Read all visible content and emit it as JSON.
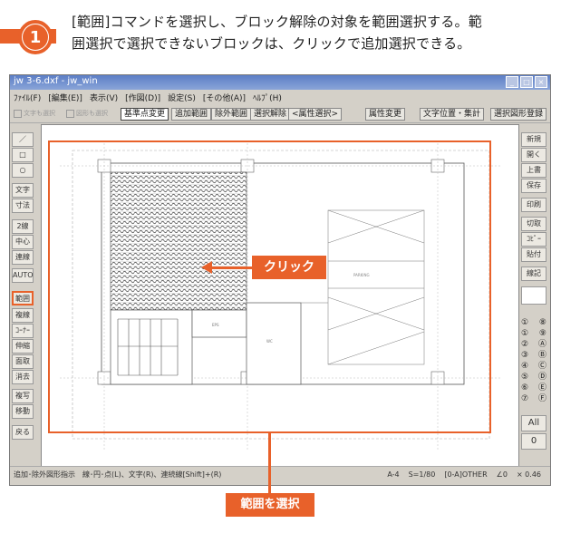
{
  "step": {
    "number": "1"
  },
  "instruction": {
    "line1": "[範囲]コマンドを選択し、ブロック解除の対象を範囲選択する。範",
    "line2": "囲選択で選択できないブロックは、クリックで追加選択できる。"
  },
  "window": {
    "title": "jw 3-6.dxf - jw_win",
    "buttons": [
      "_",
      "□",
      "×"
    ]
  },
  "menu": [
    "ﾌｧｲﾙ(F)",
    "[編集(E)]",
    "表示(V)",
    "[作図(D)]",
    "設定(S)",
    "[その他(A)]",
    "ﾍﾙﾌﾟ(H)"
  ],
  "toolbar": {
    "checks": [
      "文字も選択",
      "図形も選択"
    ],
    "buttons": [
      "基準点変更",
      "追加範囲",
      "除外範囲",
      "選択解除",
      "<属性選択>",
      "属性変更",
      "文字位置・集計",
      "選択図形登録"
    ],
    "active_index": 0
  },
  "left_tools": [
    "／",
    "□",
    "○",
    "文字",
    "寸法",
    "2線",
    "中心線",
    "連線",
    "AUTO",
    "範囲",
    "複線",
    "ｺｰﾅｰ",
    "伸縮",
    "面取",
    "消去",
    "複写",
    "移動",
    "戻る"
  ],
  "selected_tool": "範囲",
  "right_tools": [
    "新規",
    "開く",
    "上書",
    "保存",
    "印刷",
    "切取",
    "ｺﾋﾟｰ",
    "貼付",
    "線記"
  ],
  "right_layers": [
    "①",
    "⑧",
    "①",
    "⑨",
    "②",
    "Ⓐ",
    "③",
    "Ⓑ",
    "④",
    "Ⓒ",
    "⑤",
    "Ⓓ",
    "⑥",
    "Ⓔ",
    "⑦",
    "Ⓕ"
  ],
  "right_bottom": [
    "All",
    "0"
  ],
  "status": {
    "hint": "追加･除外図形指示　線･円･点(L)、文字(R)、連続線[Shift]+(R)",
    "paper": "A-4",
    "scale": "S=1/80",
    "layer": "[0-A]OTHER",
    "angle": "∠0",
    "zoom": "× 0.46"
  },
  "callouts": {
    "click": "クリック",
    "select_range": "範囲を選択"
  },
  "colors": {
    "accent": "#e8612a",
    "window_bg": "#d4d0c8",
    "titlebar": "#6d8bc9"
  }
}
